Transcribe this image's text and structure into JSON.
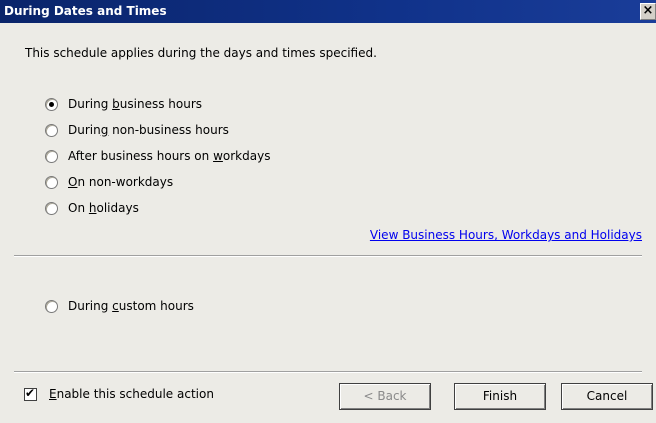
{
  "window": {
    "title": "During Dates and Times",
    "close_glyph": "×"
  },
  "intro_text": "This schedule applies during the days and times specified.",
  "options": [
    {
      "pre": "During ",
      "u": "b",
      "post": "usiness hours",
      "checked": true
    },
    {
      "pre": "Durin",
      "u": "g",
      "post": " non-business hours",
      "checked": false
    },
    {
      "pre": "After business hours on ",
      "u": "w",
      "post": "orkdays",
      "checked": false
    },
    {
      "pre": "",
      "u": "O",
      "post": "n non-workdays",
      "checked": false
    },
    {
      "pre": "On ",
      "u": "h",
      "post": "olidays",
      "checked": false
    }
  ],
  "link_text": "View Business Hours, Workdays and Holidays",
  "custom_option": {
    "pre": "During ",
    "u": "c",
    "post": "ustom hours",
    "checked": false
  },
  "enable_checkbox": {
    "pre": "",
    "u": "E",
    "post": "nable this schedule action",
    "checked": true
  },
  "buttons": {
    "back": "< Back",
    "finish": "Finish",
    "cancel": "Cancel"
  },
  "colors": {
    "titlebar": "#0a246a",
    "link": "#0000ee",
    "dialog_bg": "#ecebe6"
  },
  "icons": [
    "close-icon",
    "radio-icon",
    "checkbox-icon"
  ]
}
